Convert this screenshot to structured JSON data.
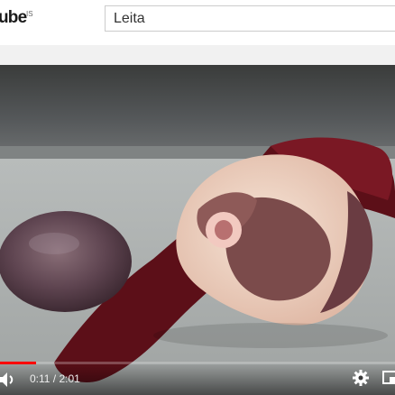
{
  "masthead": {
    "logo_text": "ube",
    "logo_region": "IS",
    "search": {
      "value": "Leita"
    }
  },
  "player": {
    "current_time": "0:11",
    "duration": "2:01",
    "time_display": "0:11 / 2:01",
    "progress_fraction": 0.091,
    "accent_color": "#ff0000",
    "icons": [
      "volume-icon",
      "settings-gear-icon",
      "miniplayer-icon"
    ]
  }
}
